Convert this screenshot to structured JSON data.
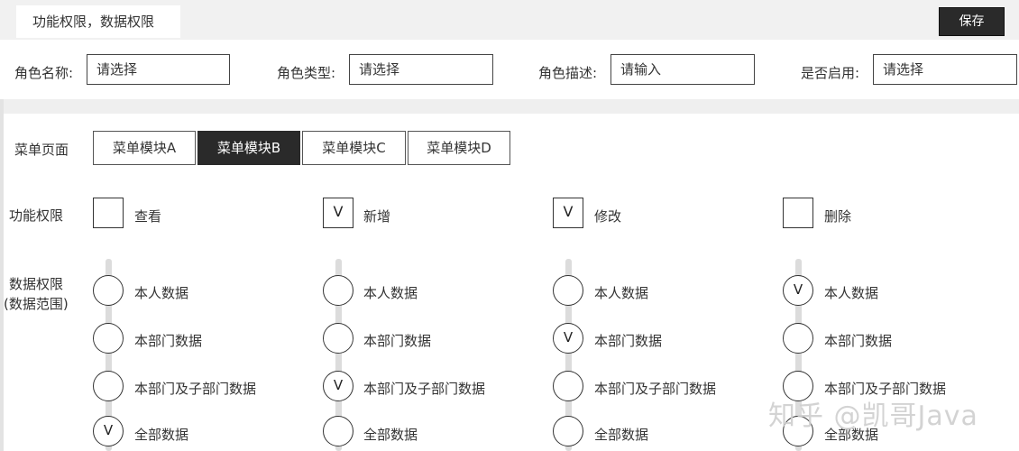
{
  "header": {
    "tab_title": "功能权限，数据权限",
    "save_label": "保存"
  },
  "filters": [
    {
      "label": "角色名称:",
      "placeholder": "请选择"
    },
    {
      "label": "角色类型:",
      "placeholder": "请选择"
    },
    {
      "label": "角色描述:",
      "placeholder": "请输入"
    },
    {
      "label": "是否启用:",
      "placeholder": "请选择"
    }
  ],
  "menu": {
    "label": "菜单页面",
    "tabs": [
      {
        "label": "菜单模块A",
        "active": false
      },
      {
        "label": "菜单模块B",
        "active": true
      },
      {
        "label": "菜单模块C",
        "active": false
      },
      {
        "label": "菜单模块D",
        "active": false
      }
    ]
  },
  "function_perm": {
    "label": "功能权限",
    "items": [
      {
        "label": "查看",
        "mark": ""
      },
      {
        "label": "新增",
        "mark": "V"
      },
      {
        "label": "修改",
        "mark": "V"
      },
      {
        "label": "删除",
        "mark": ""
      }
    ]
  },
  "data_perm": {
    "label_line1": "数据权限",
    "label_line2": "(数据范围)",
    "options": [
      "本人数据",
      "本部门数据",
      "本部门及子部门数据",
      "全部数据"
    ],
    "columns": [
      {
        "selected_mark": [
          "",
          "",
          "",
          "V"
        ]
      },
      {
        "selected_mark": [
          "",
          "",
          "V",
          ""
        ]
      },
      {
        "selected_mark": [
          "",
          "V",
          "",
          ""
        ]
      },
      {
        "selected_mark": [
          "V",
          "",
          "",
          ""
        ]
      }
    ]
  },
  "watermark": "知乎 @凯哥Java",
  "check_mark": "V"
}
